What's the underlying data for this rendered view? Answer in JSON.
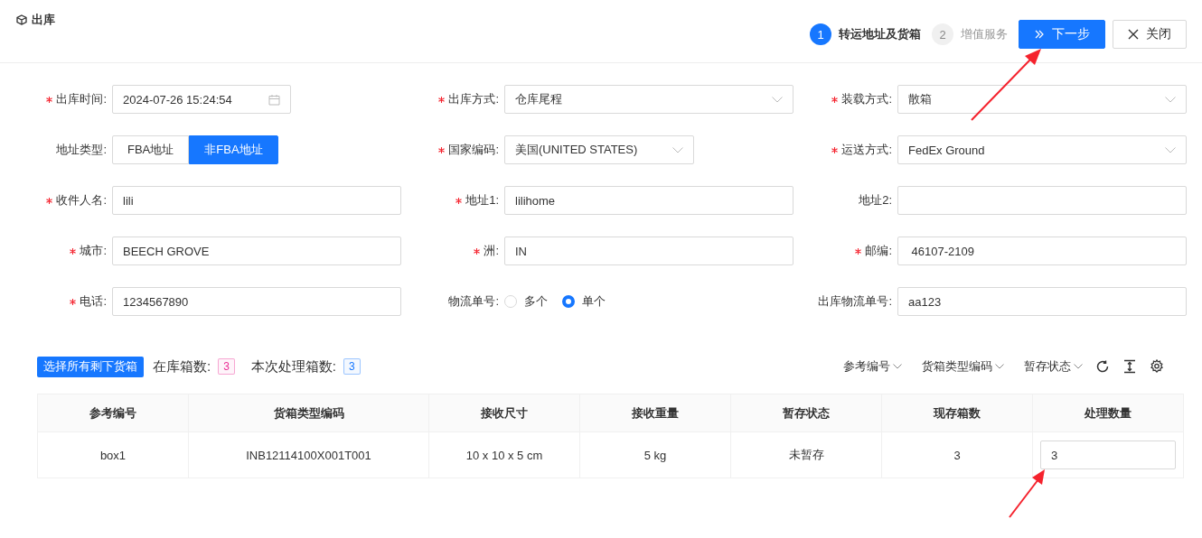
{
  "header": {
    "title": "出库",
    "steps": [
      {
        "number": "1",
        "label": "转运地址及货箱",
        "active": true
      },
      {
        "number": "2",
        "label": "增值服务",
        "active": false
      }
    ],
    "buttons": [
      {
        "kind": "next",
        "label": "下一步"
      },
      {
        "kind": "close",
        "label": "关闭"
      }
    ]
  },
  "form": {
    "rows": [
      [
        {
          "kind": "date",
          "label": "出库时间:",
          "required": true,
          "value": "2024-07-26 15:24:54"
        },
        {
          "kind": "select",
          "label": "出库方式:",
          "required": true,
          "value": "仓库尾程"
        },
        {
          "kind": "select",
          "label": "装载方式:",
          "required": true,
          "value": "散箱"
        }
      ],
      [
        {
          "kind": "segmented",
          "label": "地址类型:",
          "required": false,
          "options": [
            {
              "label": "FBA地址",
              "selected": false
            },
            {
              "label": "非FBA地址",
              "selected": true
            }
          ]
        },
        {
          "kind": "select",
          "label": "国家编码:",
          "required": true,
          "value": "美国(UNITED STATES)"
        },
        {
          "kind": "select",
          "label": "运送方式:",
          "required": true,
          "value": "FedEx Ground"
        }
      ],
      [
        {
          "kind": "input",
          "label": "收件人名:",
          "required": true,
          "value": "lili"
        },
        {
          "kind": "input",
          "label": "地址1:",
          "required": true,
          "value": "lilihome"
        },
        {
          "kind": "input",
          "label": "地址2:",
          "required": false
        }
      ],
      [
        {
          "kind": "input",
          "label": "城市:",
          "required": true,
          "value": "BEECH GROVE"
        },
        {
          "kind": "input",
          "label": "洲:",
          "required": true,
          "value": "IN"
        },
        {
          "kind": "input",
          "label": "邮编:",
          "required": true,
          "value": " 46107-2109"
        }
      ],
      [
        {
          "kind": "input",
          "label": "电话:",
          "required": true,
          "value": "1234567890"
        },
        {
          "kind": "radio",
          "label": "物流单号:",
          "required": false,
          "options": [
            {
              "label": "多个",
              "selected": false
            },
            {
              "label": "单个",
              "selected": true
            }
          ]
        },
        {
          "kind": "input",
          "label": "出库物流单号:",
          "required": false,
          "value": "aa123"
        }
      ]
    ]
  },
  "toolbar": {
    "select_button": "选择所有剩下货箱",
    "counts": [
      {
        "label": "在库箱数:",
        "value": "3",
        "color": "#eb2f96"
      },
      {
        "label": "本次处理箱数:",
        "value": "3",
        "color": "#1677ff"
      }
    ],
    "filters": [
      "参考编号",
      "货箱类型编码",
      "暂存状态"
    ]
  },
  "table": {
    "columns": [
      "参考编号",
      "货箱类型编码",
      "接收尺寸",
      "接收重量",
      "暂存状态",
      "现存箱数",
      "处理数量"
    ],
    "rows": [
      {
        "cells": [
          "box1",
          "INB12114100X001T001",
          "10 x 10 x 5 cm",
          "5 kg",
          "未暂存",
          "3"
        ],
        "quantity": "3"
      }
    ]
  }
}
